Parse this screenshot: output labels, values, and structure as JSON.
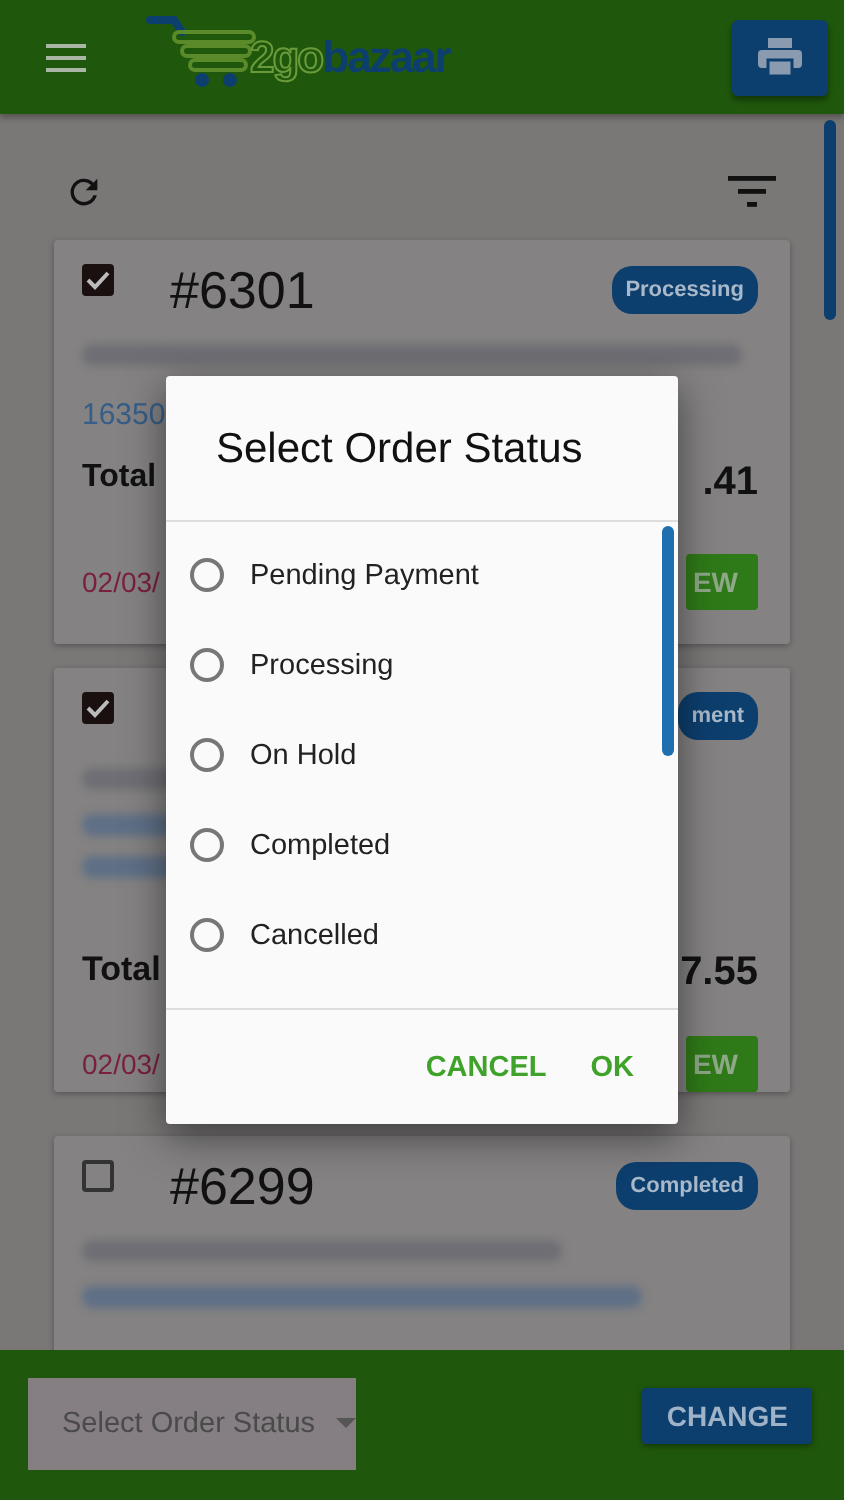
{
  "header": {
    "logo": {
      "part_1": "2go",
      "part_2": "bazaar"
    }
  },
  "orders": [
    {
      "checked": true,
      "number": "#6301",
      "status": "Processing",
      "address": "16350",
      "total_label": "Total",
      "total": ".41",
      "date": "02/03/",
      "button": "EW"
    },
    {
      "checked": true,
      "status": "ment",
      "total_label": "Total",
      "total": "7.55",
      "date": "02/03/",
      "button": "EW"
    },
    {
      "checked": false,
      "number": "#6299",
      "status": "Completed"
    }
  ],
  "dialog": {
    "title": "Select Order Status",
    "options": [
      {
        "label": "Pending Payment",
        "selected": false
      },
      {
        "label": "Processing",
        "selected": false
      },
      {
        "label": "On Hold",
        "selected": false
      },
      {
        "label": "Completed",
        "selected": false
      },
      {
        "label": "Cancelled",
        "selected": false
      }
    ],
    "buttons": [
      "CANCEL",
      "OK"
    ]
  },
  "bottom_bar": {
    "select": {
      "placeholder": "Select Order Status"
    },
    "button": "CHANGE"
  }
}
